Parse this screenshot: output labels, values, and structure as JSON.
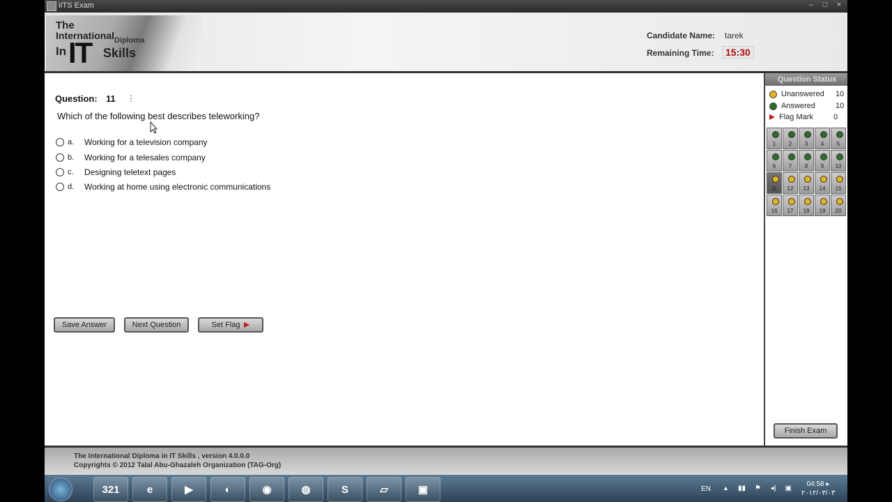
{
  "window": {
    "title": "iITS Exam"
  },
  "header": {
    "logo": {
      "line1": "The",
      "line2": "International",
      "line3": "Diploma",
      "line4": "In",
      "line5": "IT",
      "line6": "Skills"
    },
    "candidate_label": "Candidate Name:",
    "candidate_value": "tarek",
    "remaining_label": "Remaining Time:",
    "remaining_value": "15:30",
    "timer_color": "#b01010"
  },
  "question": {
    "label": "Question:",
    "number": "11",
    "dots": "⋮",
    "text": "Which of the following best describes teleworking?",
    "options": [
      {
        "letter": "a.",
        "text": "Working for a television company"
      },
      {
        "letter": "b.",
        "text": "Working for a telesales company"
      },
      {
        "letter": "c.",
        "text": "Designing teletext pages"
      },
      {
        "letter": "d.",
        "text": "Working at home using electronic communications"
      }
    ]
  },
  "buttons": {
    "save": "Save Answer",
    "next": "Next Question",
    "flag": "Set Flag"
  },
  "status": {
    "title": "Question Status",
    "unanswered_label": "Unanswered",
    "unanswered_count": "10",
    "answered_label": "Answered",
    "answered_count": "10",
    "flag_label": "Flag Mark",
    "flag_count": "0",
    "colors": {
      "unanswered": "#e6b21e",
      "answered": "#2f6b2a",
      "flag": "#c01818"
    },
    "cells": [
      {
        "n": "1",
        "state": "answered"
      },
      {
        "n": "2",
        "state": "answered"
      },
      {
        "n": "3",
        "state": "answered"
      },
      {
        "n": "4",
        "state": "answered"
      },
      {
        "n": "5",
        "state": "answered"
      },
      {
        "n": "6",
        "state": "answered"
      },
      {
        "n": "7",
        "state": "answered"
      },
      {
        "n": "8",
        "state": "answered"
      },
      {
        "n": "9",
        "state": "answered"
      },
      {
        "n": "10",
        "state": "answered"
      },
      {
        "n": "11",
        "state": "current"
      },
      {
        "n": "12",
        "state": "unanswered"
      },
      {
        "n": "13",
        "state": "unanswered"
      },
      {
        "n": "14",
        "state": "unanswered"
      },
      {
        "n": "15",
        "state": "unanswered"
      },
      {
        "n": "16",
        "state": "unanswered"
      },
      {
        "n": "17",
        "state": "unanswered"
      },
      {
        "n": "18",
        "state": "unanswered"
      },
      {
        "n": "19",
        "state": "unanswered"
      },
      {
        "n": "20",
        "state": "unanswered"
      }
    ],
    "finish": "Finish Exam"
  },
  "footer": {
    "line1": "The International Diploma in IT Skills , version 4.0.0.0",
    "line2": "Copyrights © 2012 Talal Abu-Ghazaleh Organization (TAG-Org)"
  },
  "taskbar": {
    "apps": [
      {
        "name": "calendar-app-icon",
        "glyph": "321"
      },
      {
        "name": "internet-explorer-icon",
        "glyph": "e"
      },
      {
        "name": "media-player-icon",
        "glyph": "▶"
      },
      {
        "name": "media-app-icon",
        "glyph": "◐"
      },
      {
        "name": "chrome-icon",
        "glyph": "◉"
      },
      {
        "name": "firefox-icon",
        "glyph": "◍"
      },
      {
        "name": "skype-icon",
        "glyph": "S"
      },
      {
        "name": "explorer-app-icon",
        "glyph": "▱"
      },
      {
        "name": "exam-app-icon",
        "glyph": "▣"
      }
    ],
    "lang": "EN",
    "time": "04:58 ▸",
    "date": "٢٠١٢/٠٣/٠٣"
  }
}
